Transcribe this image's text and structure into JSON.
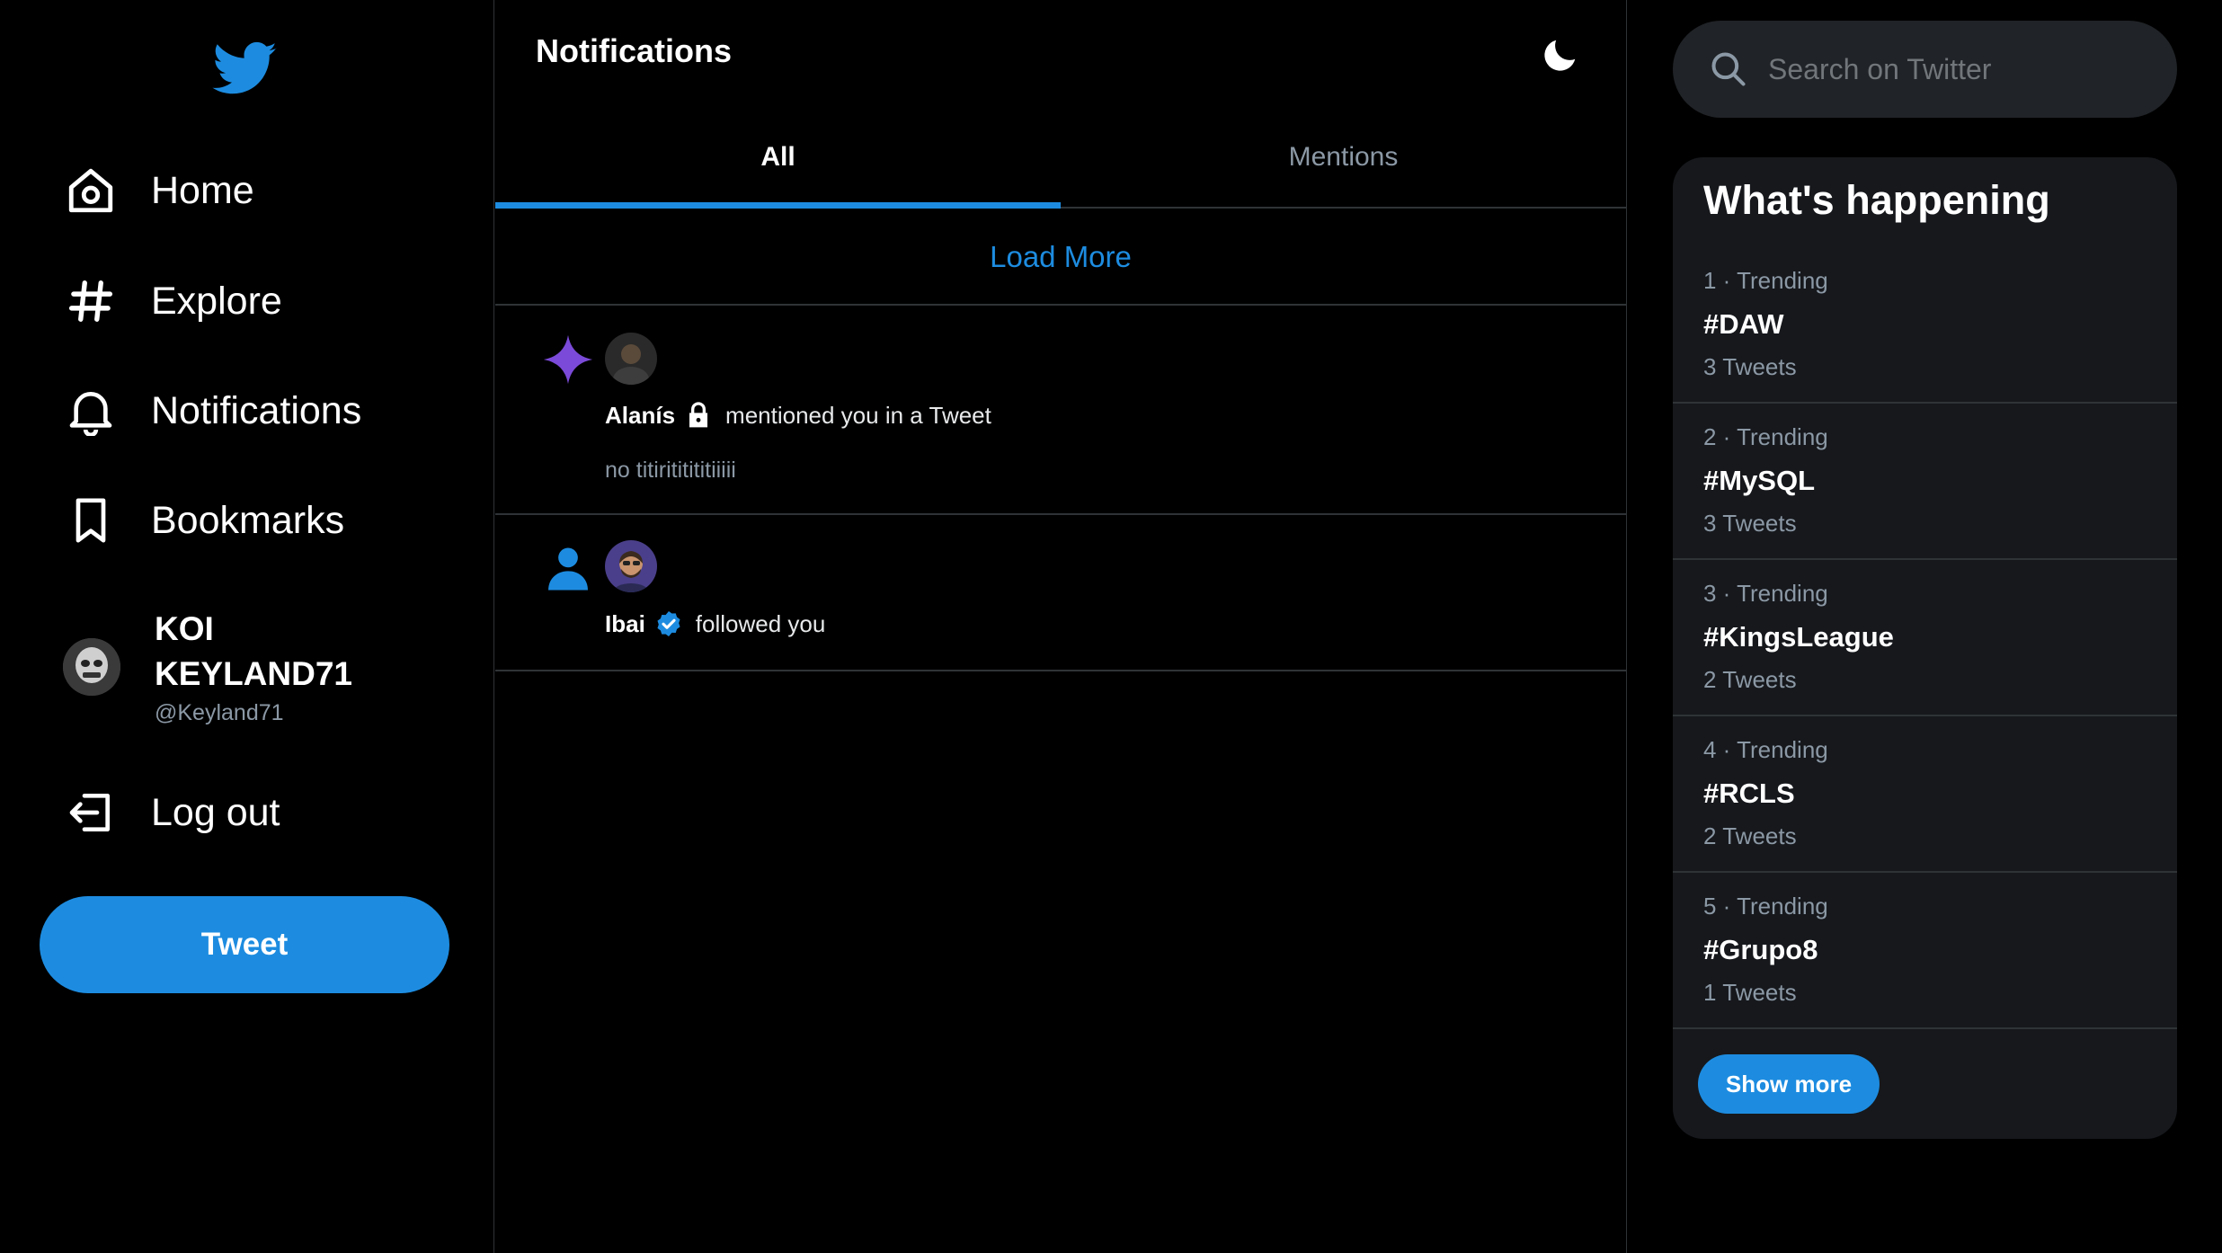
{
  "colors": {
    "accent": "#1d8ce0",
    "background": "#000000",
    "muted": "#8b98a5",
    "card": "#16181c",
    "purple_star": "#7b4ad8"
  },
  "sidebar": {
    "logo_icon": "twitter-bird-icon",
    "nav": [
      {
        "label": "Home",
        "icon": "home-icon"
      },
      {
        "label": "Explore",
        "icon": "hashtag-icon"
      },
      {
        "label": "Notifications",
        "icon": "bell-icon"
      },
      {
        "label": "Bookmarks",
        "icon": "bookmark-icon"
      }
    ],
    "profile": {
      "name": "KOI KEYLAND71",
      "handle": "@Keyland71"
    },
    "logout_label": "Log out",
    "tweet_label": "Tweet"
  },
  "main": {
    "title": "Notifications",
    "tabs": [
      {
        "label": "All",
        "active": true
      },
      {
        "label": "Mentions",
        "active": false
      }
    ],
    "load_more": "Load More",
    "notifications": [
      {
        "type": "mention",
        "icon": "sparkle-icon",
        "user": "Alanís",
        "badge": "lock-icon",
        "action": "mentioned you in a Tweet",
        "preview": "no titirititititiiiii"
      },
      {
        "type": "follow",
        "icon": "person-icon",
        "user": "Ibai",
        "badge": "verified-icon",
        "action": "followed you"
      }
    ]
  },
  "right": {
    "search_placeholder": "Search on Twitter",
    "trends_title": "What's happening",
    "trends": [
      {
        "meta": "1 · Trending",
        "tag": "#DAW",
        "count": "3 Tweets"
      },
      {
        "meta": "2 · Trending",
        "tag": "#MySQL",
        "count": "3 Tweets"
      },
      {
        "meta": "3 · Trending",
        "tag": "#KingsLeague",
        "count": "2 Tweets"
      },
      {
        "meta": "4 · Trending",
        "tag": "#RCLS",
        "count": "2 Tweets"
      },
      {
        "meta": "5 · Trending",
        "tag": "#Grupo8",
        "count": "1 Tweets"
      }
    ],
    "show_more": "Show more"
  }
}
